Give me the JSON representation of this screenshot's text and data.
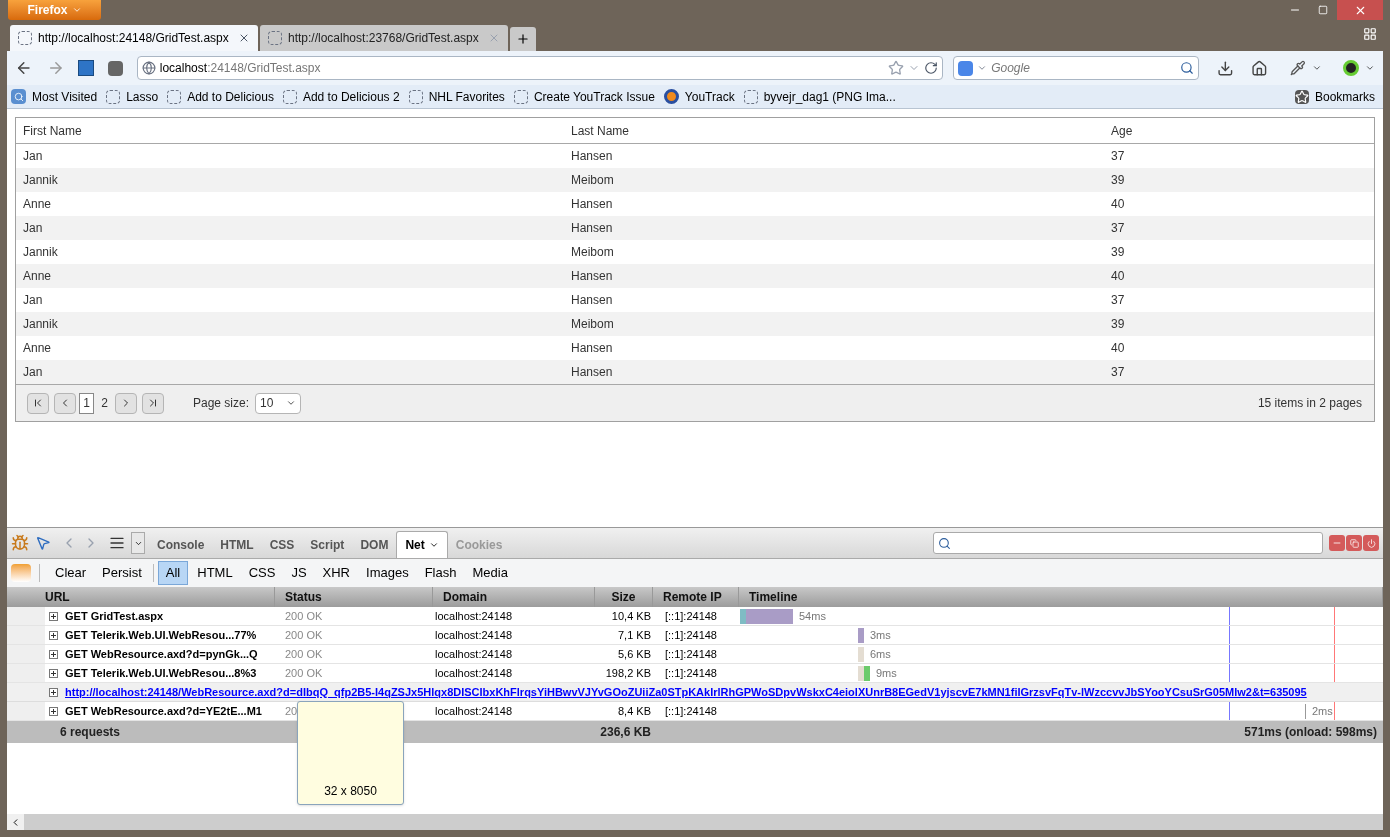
{
  "app_button": "Firefox",
  "tabs": [
    {
      "title": "http://localhost:24148/GridTest.aspx",
      "selected": true
    },
    {
      "title": "http://localhost:23768/GridTest.aspx",
      "selected": false
    }
  ],
  "address": {
    "host": "localhost",
    "rest": ":24148/GridTest.aspx"
  },
  "search": {
    "placeholder": "Google"
  },
  "bookmarks": [
    {
      "label": "Most Visited",
      "kind": "folder"
    },
    {
      "label": "Lasso",
      "kind": "page"
    },
    {
      "label": "Add to Delicious",
      "kind": "page"
    },
    {
      "label": "Add to Delicious 2",
      "kind": "page"
    },
    {
      "label": "NHL Favorites",
      "kind": "page"
    },
    {
      "label": "Create YouTrack Issue",
      "kind": "page"
    },
    {
      "label": "YouTrack",
      "kind": "app"
    },
    {
      "label": "byvejr_dag1 (PNG Ima...",
      "kind": "page"
    }
  ],
  "bookmarks_menu": "Bookmarks",
  "grid": {
    "columns": [
      "First Name",
      "Last Name",
      "Age"
    ],
    "rows": [
      [
        "Jan",
        "Hansen",
        "37"
      ],
      [
        "Jannik",
        "Meibom",
        "39"
      ],
      [
        "Anne",
        "Hansen",
        "40"
      ],
      [
        "Jan",
        "Hansen",
        "37"
      ],
      [
        "Jannik",
        "Meibom",
        "39"
      ],
      [
        "Anne",
        "Hansen",
        "40"
      ],
      [
        "Jan",
        "Hansen",
        "37"
      ],
      [
        "Jannik",
        "Meibom",
        "39"
      ],
      [
        "Anne",
        "Hansen",
        "40"
      ],
      [
        "Jan",
        "Hansen",
        "37"
      ]
    ],
    "pager": {
      "pages": [
        {
          "label": "1",
          "selected": true
        },
        {
          "label": "2",
          "selected": false
        }
      ],
      "page_size_label": "Page size:",
      "page_size": "10",
      "summary": "15 items in 2 pages"
    }
  },
  "firebug": {
    "panels": [
      {
        "label": "Console",
        "selected": false
      },
      {
        "label": "HTML",
        "selected": false
      },
      {
        "label": "CSS",
        "selected": false
      },
      {
        "label": "Script",
        "selected": false
      },
      {
        "label": "DOM",
        "selected": false
      },
      {
        "label": "Net",
        "selected": true
      },
      {
        "label": "Cookies",
        "selected": false
      }
    ],
    "actions": [
      "Clear",
      "Persist"
    ],
    "filters": [
      {
        "label": "All",
        "selected": true
      },
      {
        "label": "HTML",
        "selected": false
      },
      {
        "label": "CSS",
        "selected": false
      },
      {
        "label": "JS",
        "selected": false
      },
      {
        "label": "XHR",
        "selected": false
      },
      {
        "label": "Images",
        "selected": false
      },
      {
        "label": "Flash",
        "selected": false
      },
      {
        "label": "Media",
        "selected": false
      }
    ],
    "columns": [
      "URL",
      "Status",
      "Domain",
      "Size",
      "Remote IP",
      "Timeline"
    ],
    "requests": [
      {
        "kind": "request",
        "url": "GET GridTest.aspx",
        "status": "200 OK",
        "domain": "localhost:24148",
        "size": "10,4 KB",
        "remote_ip": "[::1]:24148",
        "time": "54ms"
      },
      {
        "kind": "request",
        "url": "GET Telerik.Web.UI.WebResou...77%",
        "status": "200 OK",
        "domain": "localhost:24148",
        "size": "7,1 KB",
        "remote_ip": "[::1]:24148",
        "time": "3ms"
      },
      {
        "kind": "request",
        "url": "GET WebResource.axd?d=pynGk...Q",
        "status": "200 OK",
        "domain": "localhost:24148",
        "size": "5,6 KB",
        "remote_ip": "[::1]:24148",
        "time": "6ms"
      },
      {
        "kind": "request",
        "url": "GET Telerik.Web.UI.WebResou...8%3",
        "status": "200 OK",
        "domain": "localhost:24148",
        "size": "198,2 KB",
        "remote_ip": "[::1]:24148",
        "time": "9ms"
      },
      {
        "kind": "link",
        "url": "http://localhost:24148/WebResource.axd?d=dIbqQ_qfp2B5-I4qZSJx5Hlqx8DISCIbxKhFlrqsYiHBwvVJYvGOoZUiiZa0STpKAkIrlRhGPWoSDpvWskxC4eiolXUnrB8EGedV1yjscvE7kMN1fiIGrzsvFqTv-lWzccvvJbSYooYCsuSrG05Mlw2&t=635095"
      },
      {
        "kind": "request",
        "url": "GET WebResource.axd?d=YE2tE...M1",
        "status": "20",
        "domain": "localhost:24148",
        "size": "8,4 KB",
        "remote_ip": "[::1]:24148",
        "time": "2ms"
      }
    ],
    "summary": {
      "count": "6 requests",
      "size": "236,6 KB",
      "timing": "571ms (onload: 598ms)"
    },
    "tooltip": "32 x 8050"
  }
}
